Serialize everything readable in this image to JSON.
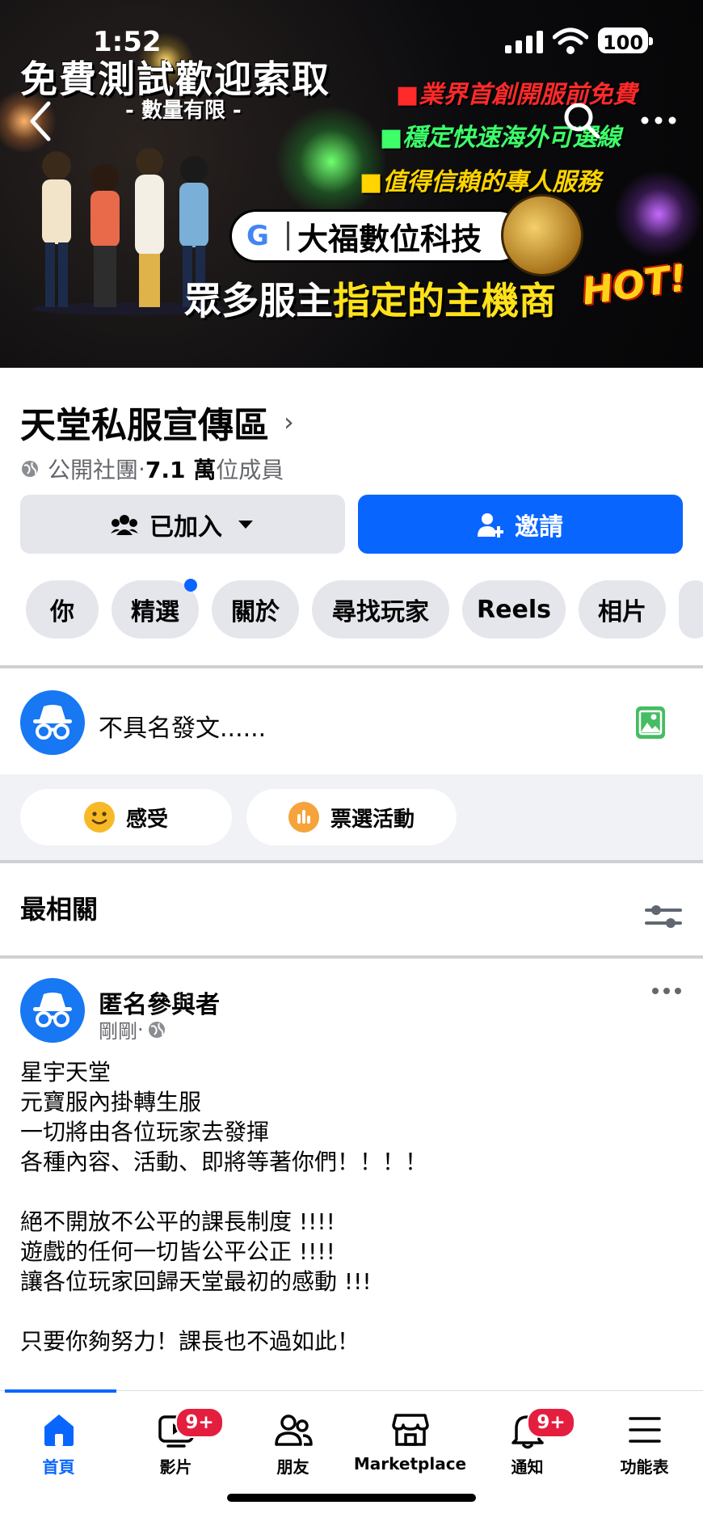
{
  "status_bar": {
    "time": "1:52",
    "battery": "100"
  },
  "cover": {
    "title": "免費測試歡迎索取",
    "subtitle": "- 數量有限 -",
    "lines": [
      "■業界首創開服前免費",
      "■穩定快速海外可選線",
      "■值得信賴的專人服務"
    ],
    "pill_logo": "G",
    "brand": "大福數位科技",
    "bottom_text_1": "眾多服主",
    "bottom_text_2": "指定的主機商",
    "hot": "HOT!"
  },
  "group": {
    "name": "天堂私服宣傳區",
    "privacy": "公開社團",
    "sep": " · ",
    "members_count": "7.1 萬",
    "members_suffix": "位成員"
  },
  "buttons": {
    "joined": "已加入",
    "invite": "邀請"
  },
  "tabs": [
    "你",
    "精選",
    "關於",
    "尋找玩家",
    "Reels",
    "相片"
  ],
  "composer": {
    "placeholder": "不具名發文......"
  },
  "actions": {
    "feeling": "感受",
    "poll": "票選活動"
  },
  "sort": {
    "label": "最相關"
  },
  "post": {
    "author": "匿名參與者",
    "time": "剛剛",
    "time_sep": " · ",
    "body": "星宇天堂\n元寶服內掛轉生服\n一切將由各位玩家去發揮\n各種內容、活動、即將等著你們！！！！\n\n絕不開放不公平的課長制度 !!!!\n遊戲的任何一切皆公平公正 !!!!\n讓各位玩家回歸天堂最初的感動 !!!\n\n只要你夠努力！課長也不過如此！"
  },
  "bottom_nav": {
    "items": [
      {
        "label": "首頁",
        "icon": "home-icon"
      },
      {
        "label": "影片",
        "icon": "video-icon",
        "badge": "9+"
      },
      {
        "label": "朋友",
        "icon": "friends-icon"
      },
      {
        "label": "Marketplace",
        "icon": "marketplace-icon"
      },
      {
        "label": "通知",
        "icon": "bell-icon",
        "badge": "9+"
      },
      {
        "label": "功能表",
        "icon": "menu-icon"
      }
    ]
  },
  "colors": {
    "accent": "#0866ff",
    "badge": "#e41e3f",
    "chip_bg": "#e4e6eb"
  }
}
